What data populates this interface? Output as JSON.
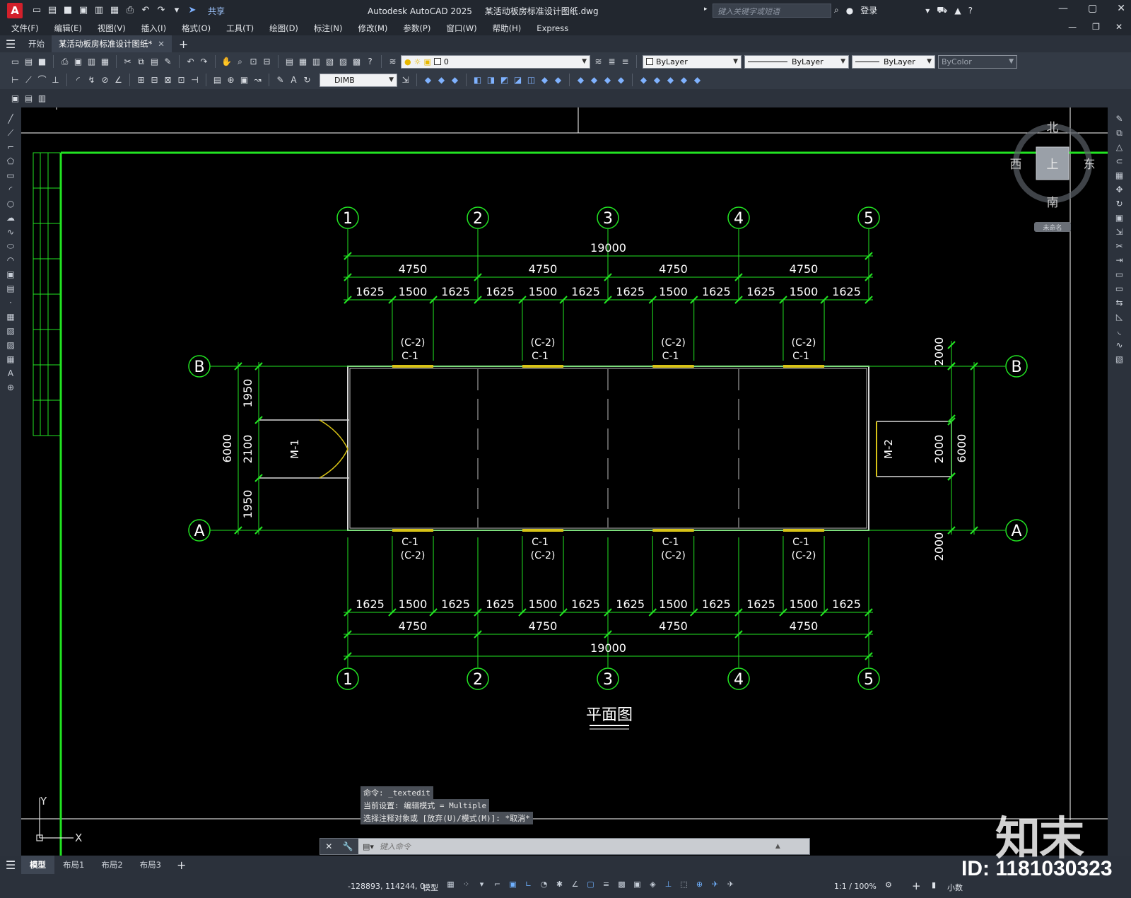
{
  "titlebar": {
    "app_badge": "A",
    "share_label": "共享",
    "app_name": "Autodesk AutoCAD 2025",
    "file_name": "某活动板房标准设计图纸.dwg",
    "search_placeholder": "键入关键字或短语",
    "login_label": "登录"
  },
  "menu": [
    "文件(F)",
    "编辑(E)",
    "视图(V)",
    "插入(I)",
    "格式(O)",
    "工具(T)",
    "绘图(D)",
    "标注(N)",
    "修改(M)",
    "参数(P)",
    "窗口(W)",
    "帮助(H)",
    "Express"
  ],
  "tabs": {
    "start": "开始",
    "doc": "某活动板房标准设计图纸*"
  },
  "properties": {
    "layer": "0",
    "color": "ByLayer",
    "linetype": "ByLayer",
    "lineweight": "ByLayer",
    "plotstyle": "ByColor",
    "dimstyle": "DIMB"
  },
  "viewcube": {
    "north": "北",
    "south": "南",
    "east": "东",
    "west": "西",
    "top": "上",
    "wcs": "未命名"
  },
  "drawing": {
    "title": "平面图",
    "grid_cols": [
      "1",
      "2",
      "3",
      "4",
      "5"
    ],
    "grid_rows": [
      "A",
      "B"
    ],
    "total": "19000",
    "bays": [
      "4750",
      "4750",
      "4750",
      "4750"
    ],
    "sub_dims": [
      "1625",
      "1500",
      "1625"
    ],
    "window_top": [
      "(C-2)",
      "C-1"
    ],
    "window_bottom": [
      "C-1",
      "(C-2)"
    ],
    "doors": [
      "M-1",
      "M-2"
    ],
    "left_dims": [
      "6000",
      "1950",
      "2100",
      "1950"
    ],
    "right_dims": [
      "2000",
      "2000",
      "6000",
      "2000"
    ]
  },
  "ucs": {
    "y": "Y",
    "x": "X"
  },
  "command": {
    "history": [
      "命令: _textedit",
      "当前设置: 编辑模式 = Multiple",
      "选择注释对象或 [放弃(U)/模式(M)]: *取消*"
    ],
    "placeholder": "键入命令"
  },
  "layout_tabs": [
    "模型",
    "布局1",
    "布局2",
    "布局3"
  ],
  "status": {
    "coords": "-128893, 114244, 0",
    "mode": "模型",
    "scale": "1:1 / 100%",
    "units": "小数"
  },
  "watermark": {
    "logo": "知末",
    "id": "ID: 1181030323"
  },
  "colors": {
    "grid_green": "#22e422",
    "bg": "#000000",
    "chrome": "#2b313b",
    "door_yellow": "#d8c316"
  }
}
